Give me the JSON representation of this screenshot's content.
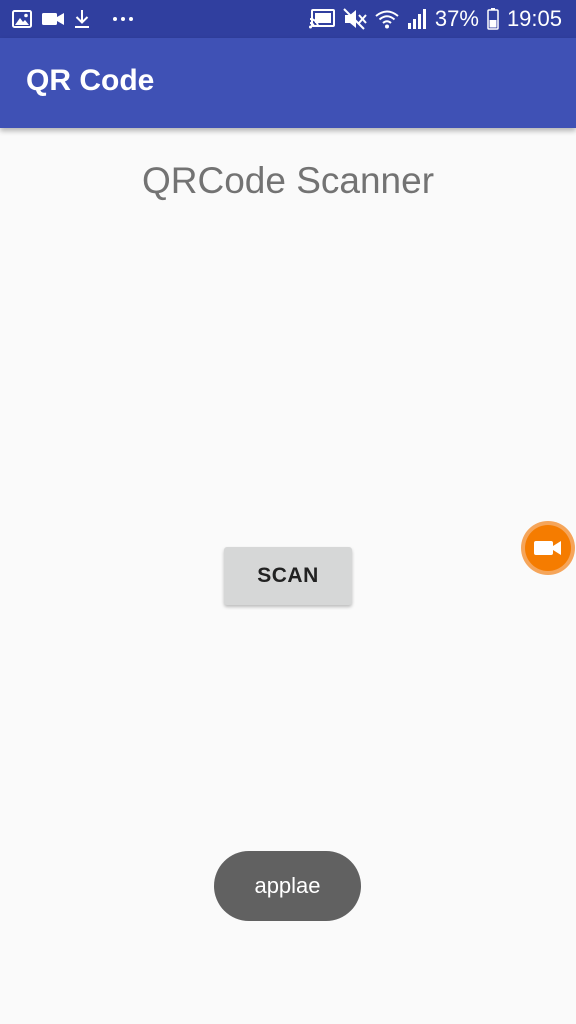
{
  "status_bar": {
    "battery_percent": "37%",
    "time": "19:05",
    "left_icons": [
      "gallery-icon",
      "video-camera-icon",
      "download-icon",
      "more-dots-icon"
    ],
    "right_icons": [
      "cast-icon",
      "mute-icon",
      "wifi-icon",
      "signal-icon",
      "battery-icon"
    ]
  },
  "app_bar": {
    "title": "QR Code",
    "color": "#3f51b5"
  },
  "main": {
    "heading": "QRCode Scanner",
    "scan_button_label": "SCAN"
  },
  "floating_button": {
    "icon": "video-camera-icon",
    "color": "#f57c00"
  },
  "toast": {
    "text": "applae"
  }
}
